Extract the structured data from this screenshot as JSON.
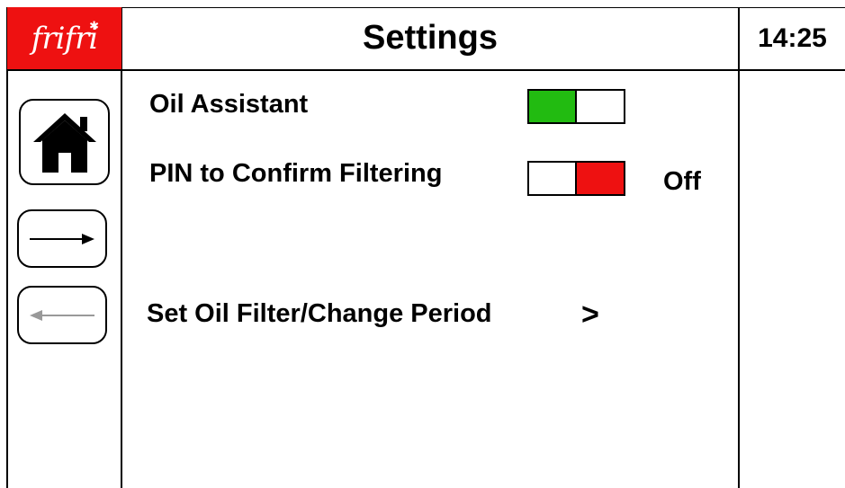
{
  "header": {
    "logo_text": "frifri",
    "title": "Settings",
    "clock": "14:25"
  },
  "sidebar": {
    "home_icon": "home-icon",
    "forward_icon": "arrow-right-icon",
    "back_icon": "arrow-left-icon",
    "back_disabled": true
  },
  "settings": {
    "oil_assistant": {
      "label": "Oil Assistant",
      "state": "on",
      "on_color": "#22bb11"
    },
    "pin_confirm": {
      "label": "PIN to Confirm Filtering",
      "state": "off",
      "state_text": "Off",
      "off_color": "#ee1111"
    },
    "period": {
      "label": "Set Oil Filter/Change Period",
      "chevron": ">"
    }
  },
  "colors": {
    "brand_red": "#ee1111",
    "toggle_on": "#22bb11",
    "toggle_off": "#ee1111",
    "disabled_icon": "#999999"
  }
}
